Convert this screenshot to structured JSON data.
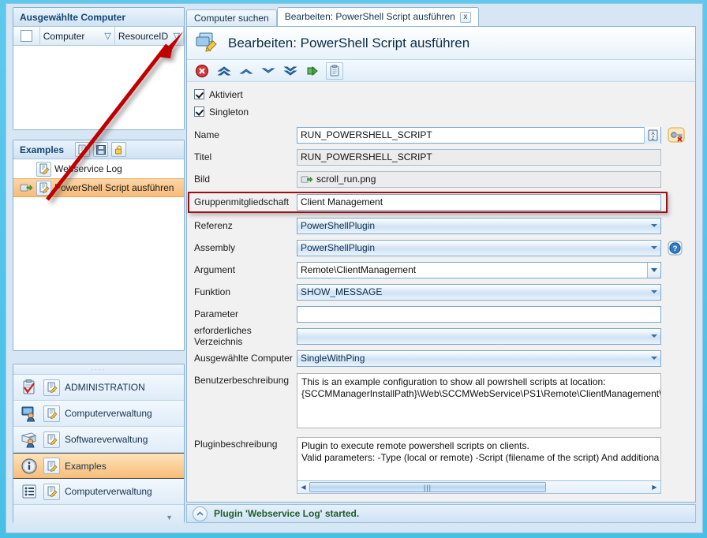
{
  "left_panel": {
    "selected_computers": {
      "title": "Ausgewählte Computer",
      "columns": [
        "Computer",
        "ResourceID"
      ],
      "rows": []
    },
    "examples": {
      "title": "Examples",
      "toolbar_icons": [
        "edit-icon",
        "save-icon",
        "lock-icon"
      ],
      "items": [
        {
          "label": "Webservice Log",
          "selected": false
        },
        {
          "label": "PowerShell Script ausführen",
          "selected": true
        }
      ]
    },
    "nav": {
      "items": [
        {
          "label": "ADMINISTRATION",
          "icon": "clipboard-check-icon",
          "active": false
        },
        {
          "label": "Computerverwaltung",
          "icon": "monitor-user-icon",
          "active": false
        },
        {
          "label": "Softwareverwaltung",
          "icon": "software-user-icon",
          "active": false
        },
        {
          "label": "Examples",
          "icon": "info-icon",
          "active": true
        },
        {
          "label": "Computerverwaltung",
          "icon": "list-icon",
          "active": false
        }
      ]
    }
  },
  "tabs": [
    {
      "label": "Computer suchen",
      "active": false,
      "closable": false
    },
    {
      "label": "Bearbeiten: PowerShell Script ausführen",
      "active": true,
      "closable": true,
      "close_label": "x"
    }
  ],
  "card": {
    "title": "Bearbeiten: PowerShell Script ausführen",
    "title_icon": "edit-window-icon",
    "toolbar": [
      {
        "name": "cancel-icon"
      },
      {
        "name": "move-top-icon"
      },
      {
        "name": "move-up-icon"
      },
      {
        "name": "move-down-icon"
      },
      {
        "name": "move-bottom-icon"
      },
      {
        "name": "export-icon"
      },
      {
        "name": "paste-icon"
      }
    ]
  },
  "form": {
    "checkboxes": [
      {
        "label": "Aktiviert",
        "checked": true
      },
      {
        "label": "Singleton",
        "checked": true
      }
    ],
    "fields": [
      {
        "label": "Name",
        "value": "RUN_POWERSHELL_SCRIPT",
        "type": "text",
        "side_icon": "sort-az-icon",
        "right_icon": "key-disabled-icon"
      },
      {
        "label": "Titel",
        "value": "RUN_POWERSHELL_SCRIPT",
        "type": "readonly"
      },
      {
        "label": "Bild",
        "value": "scroll_run.png",
        "type": "readonly",
        "value_icon": "scroll-run-icon"
      },
      {
        "label": "Gruppenmitgliedschaft",
        "value": "Client Management",
        "type": "text",
        "highlighted": true
      },
      {
        "label": "Referenz",
        "value": "PowerShellPlugin",
        "type": "combo"
      },
      {
        "label": "Assembly",
        "value": "PowerShellPlugin",
        "type": "combo",
        "right_icon": "help-icon"
      },
      {
        "label": "Argument",
        "value": "Remote\\ClientManagement",
        "type": "dropdown"
      },
      {
        "label": "Funktion",
        "value": "SHOW_MESSAGE",
        "type": "combo"
      },
      {
        "label": "Parameter",
        "value": "",
        "type": "text"
      },
      {
        "label": "erforderliches Verzeichnis",
        "value": "",
        "type": "combo"
      },
      {
        "label": "Ausgewählte Computer",
        "value": "SingleWithPing",
        "type": "combo"
      }
    ],
    "textareas": [
      {
        "label": "Benutzerbeschreibung",
        "value": "This is an example configuration to show all powrshell scripts at location:\n{SCCMManagerInstallPath}\\Web\\SCCMWebService\\PS1\\Remote\\ClientManagement\\"
      },
      {
        "label": "Pluginbeschreibung",
        "value": "Plugin to execute remote powershell scripts on clients.\nValid parameters: -Type (local or remote) -Script (filename of the script) And additiona"
      }
    ],
    "hscrollbar": {
      "left_arrow": "◀",
      "right_arrow": "▶",
      "grip": "|||"
    }
  },
  "status": {
    "icon": "collapse-up-icon",
    "message": "Plugin 'Webservice Log' started."
  },
  "colors": {
    "accent_blue": "#4ec3e8",
    "highlight_red": "#9d0e15",
    "selection_orange": "#f7bb78",
    "status_green": "#1f5c2a",
    "field_blue": "#cfe2f5"
  }
}
